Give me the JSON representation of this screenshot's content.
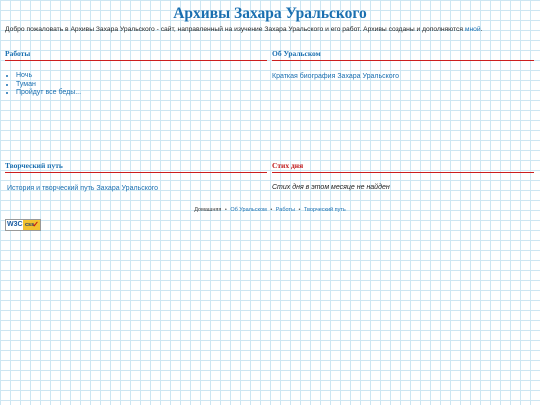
{
  "header": {
    "title": "Архивы Захара Уральского"
  },
  "intro": {
    "text": "Добро пожаловать в Архивы Захара Уральского - сайт, направленный на изучение Захара Уральского и его работ. Архивы созданы и дополняются ",
    "link": "мной",
    "end": "."
  },
  "sections": {
    "works": {
      "heading": "Работы",
      "items": [
        "Ночь",
        "Туман",
        "Пройдут все беды..."
      ]
    },
    "about": {
      "heading": "Об Уральском",
      "link": "Краткая биография Захара Уральского"
    },
    "path": {
      "heading": "Творческий путь",
      "link": "История и творческий путь Захара Уральского"
    },
    "poem": {
      "heading": "Стих дня",
      "empty_text": "Стих дня в этом месяце не найден"
    }
  },
  "footer": {
    "home": "Домашняя",
    "separator": "•",
    "links": [
      "Об Уральском",
      "Работы",
      "Творческий путь"
    ]
  },
  "badge": {
    "left": "W3C",
    "right": "css",
    "icon": "checkmark-icon"
  },
  "colors": {
    "link": "#1a6fb0",
    "accent_red": "#c0181a",
    "grid": "#cde6f2"
  }
}
